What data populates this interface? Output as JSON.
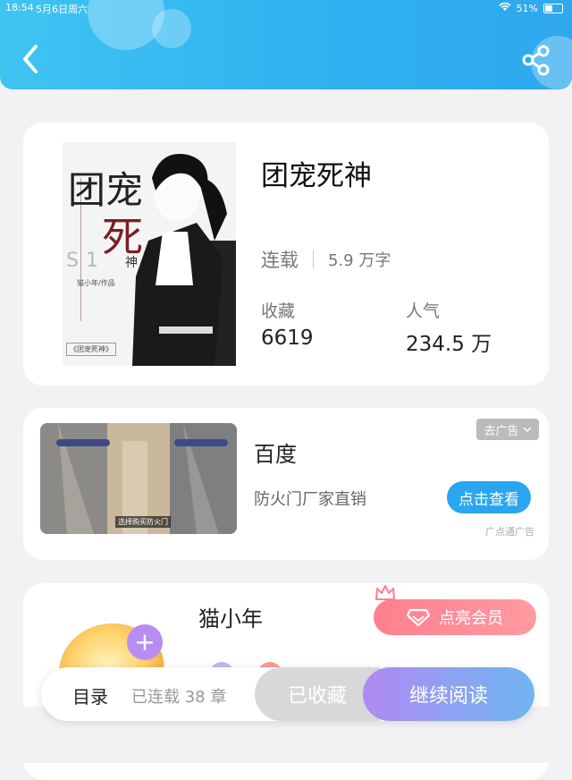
{
  "status_bar": {
    "time": "18:54",
    "date": "5月6日周六",
    "battery": "51%",
    "battery_level": 0.51
  },
  "header": {
    "accent_color": "#2fb0f0"
  },
  "book": {
    "title": "团宠死神",
    "status": "连载",
    "word_count": "5.9 万字",
    "favorites_label": "收藏",
    "favorites_value": "6619",
    "popularity_label": "人气",
    "popularity_value": "234.5 万",
    "cover": {
      "title_line1": "团宠",
      "title_line2": "死",
      "title_line3": "神",
      "author_note": "猫小年/作品",
      "side_text": "S1",
      "small_caption": "《团宠死神》"
    }
  },
  "ad": {
    "title": "百度",
    "description": "防火门厂家直销",
    "close_label": "去广告",
    "cta_label": "点击查看",
    "source": "广点通广告",
    "image_caption": "选择购买防火门"
  },
  "author": {
    "name": "猫小年",
    "follow_symbol": "+",
    "vip_label": "点亮会员",
    "vip_color": "#ff8a95"
  },
  "bottom_bar": {
    "toc_label": "目录",
    "chapter_info": "已连载 38 章",
    "collected_label": "已收藏",
    "read_label": "继续阅读"
  }
}
